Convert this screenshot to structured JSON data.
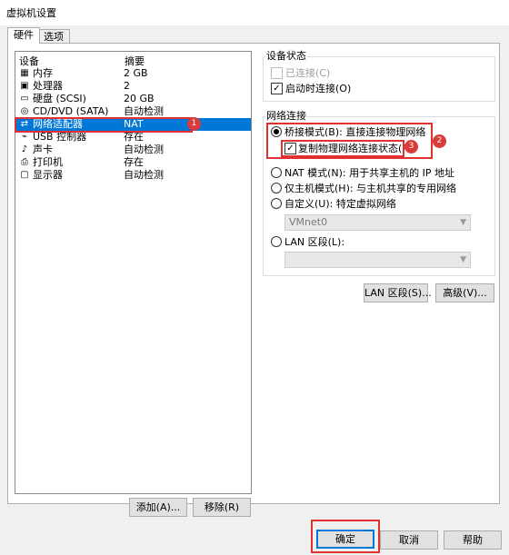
{
  "window": {
    "title": "虚拟机设置"
  },
  "tabs": [
    {
      "label": "硬件",
      "active": true
    },
    {
      "label": "选项",
      "active": false
    }
  ],
  "device_list": {
    "headers": {
      "device": "设备",
      "summary": "摘要"
    },
    "items": [
      {
        "icon": "memory-icon",
        "name": "内存",
        "summary": "2 GB"
      },
      {
        "icon": "cpu-icon",
        "name": "处理器",
        "summary": "2"
      },
      {
        "icon": "hard-disk-icon",
        "name": "硬盘 (SCSI)",
        "summary": "20 GB"
      },
      {
        "icon": "cd-dvd-icon",
        "name": "CD/DVD (SATA)",
        "summary": "自动检测"
      },
      {
        "icon": "network-adapter-icon",
        "name": "网络适配器",
        "summary": "NAT",
        "selected": true
      },
      {
        "icon": "usb-icon",
        "name": "USB 控制器",
        "summary": "存在"
      },
      {
        "icon": "sound-card-icon",
        "name": "声卡",
        "summary": "自动检测"
      },
      {
        "icon": "printer-icon",
        "name": "打印机",
        "summary": "存在"
      },
      {
        "icon": "display-icon",
        "name": "显示器",
        "summary": "自动检测"
      }
    ],
    "add_label": "添加(A)...",
    "remove_label": "移除(R)"
  },
  "device_status": {
    "title": "设备状态",
    "connected": {
      "label": "已连接(C)",
      "checked": false,
      "enabled": false
    },
    "connect_at_power_on": {
      "label": "启动时连接(O)",
      "checked": true,
      "enabled": true
    }
  },
  "network_connection": {
    "title": "网络连接",
    "bridged": {
      "label": "桥接模式(B): 直接连接物理网络",
      "selected": true
    },
    "replicate": {
      "label": "复制物理网络连接状态(P)",
      "checked": true
    },
    "nat": {
      "label": "NAT 模式(N): 用于共享主机的 IP 地址",
      "selected": false
    },
    "host_only": {
      "label": "仅主机模式(H): 与主机共享的专用网络",
      "selected": false
    },
    "custom": {
      "label": "自定义(U): 特定虚拟网络",
      "selected": false,
      "value": "VMnet0"
    },
    "lan_segment": {
      "label": "LAN 区段(L):",
      "selected": false,
      "value": ""
    },
    "lan_segments_button": "LAN 区段(S)...",
    "advanced_button": "高级(V)..."
  },
  "annotations": [
    "1",
    "2",
    "3"
  ],
  "footer": {
    "ok": "确定",
    "cancel": "取消",
    "help": "帮助"
  },
  "colors": {
    "selection": "#0078d7",
    "highlight": "#e03030",
    "badge": "#d93a3a"
  }
}
